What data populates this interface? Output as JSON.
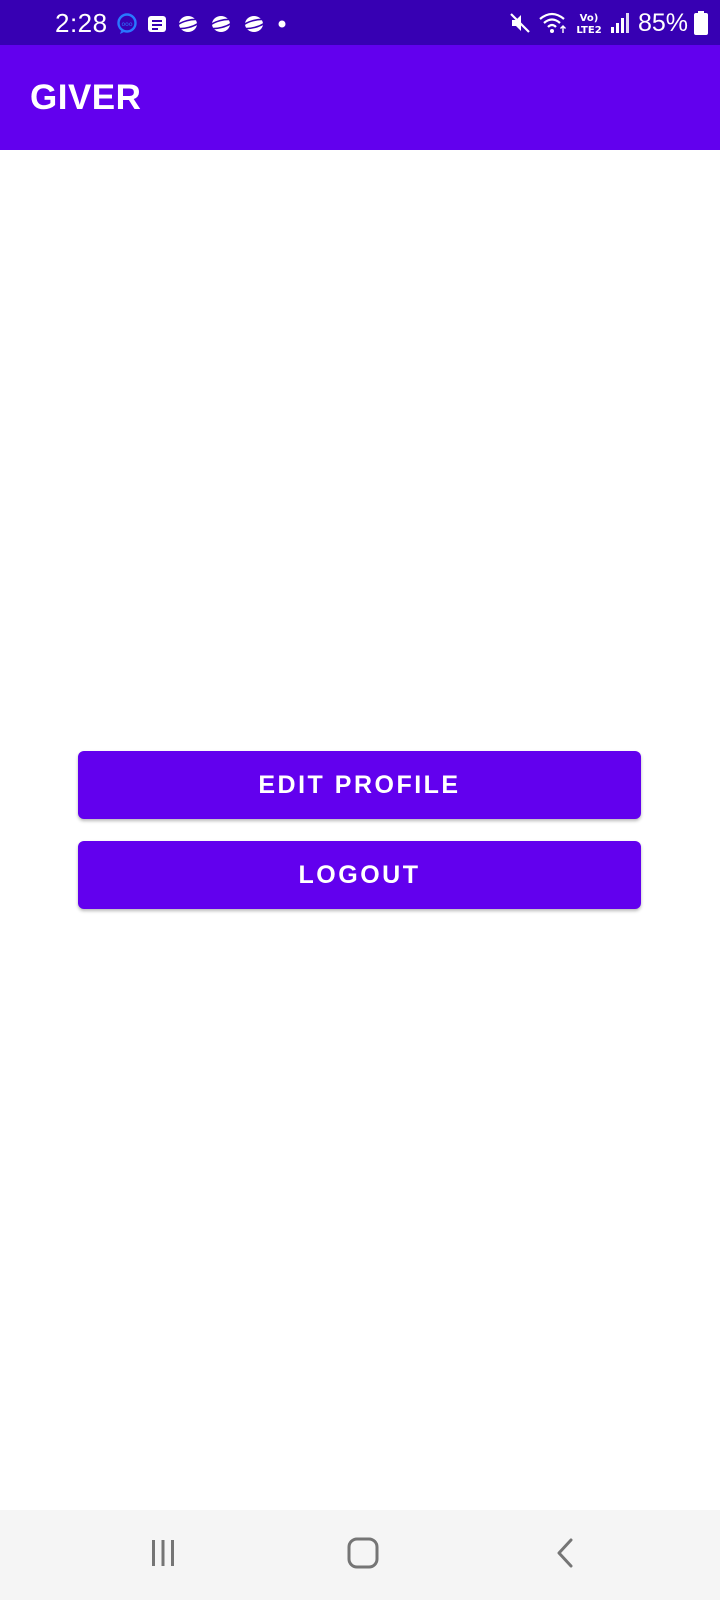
{
  "status_bar": {
    "time": "2:28",
    "battery_percent": "85%",
    "network_label_top": "Vo)",
    "network_label_bottom": "LTE2",
    "left_icons": [
      "messenger-icon",
      "news-icon",
      "saturn-icon",
      "saturn-icon",
      "saturn-icon",
      "dot-icon"
    ],
    "right_icons": [
      "mute-icon",
      "wifi-icon",
      "volte-icon",
      "signal-icon",
      "battery-icon"
    ]
  },
  "app_bar": {
    "title": "GIVER"
  },
  "actions": {
    "edit_profile_label": "EDIT PROFILE",
    "logout_label": "LOGOUT"
  },
  "nav_bar": {
    "icons": [
      "recents-icon",
      "home-icon",
      "back-icon"
    ]
  },
  "colors": {
    "status_bar": "#3700b3",
    "primary": "#6200ee",
    "background": "#ffffff",
    "nav_bar": "#f5f5f5",
    "nav_icon": "#757575",
    "messenger_accent": "#1a73e8"
  }
}
